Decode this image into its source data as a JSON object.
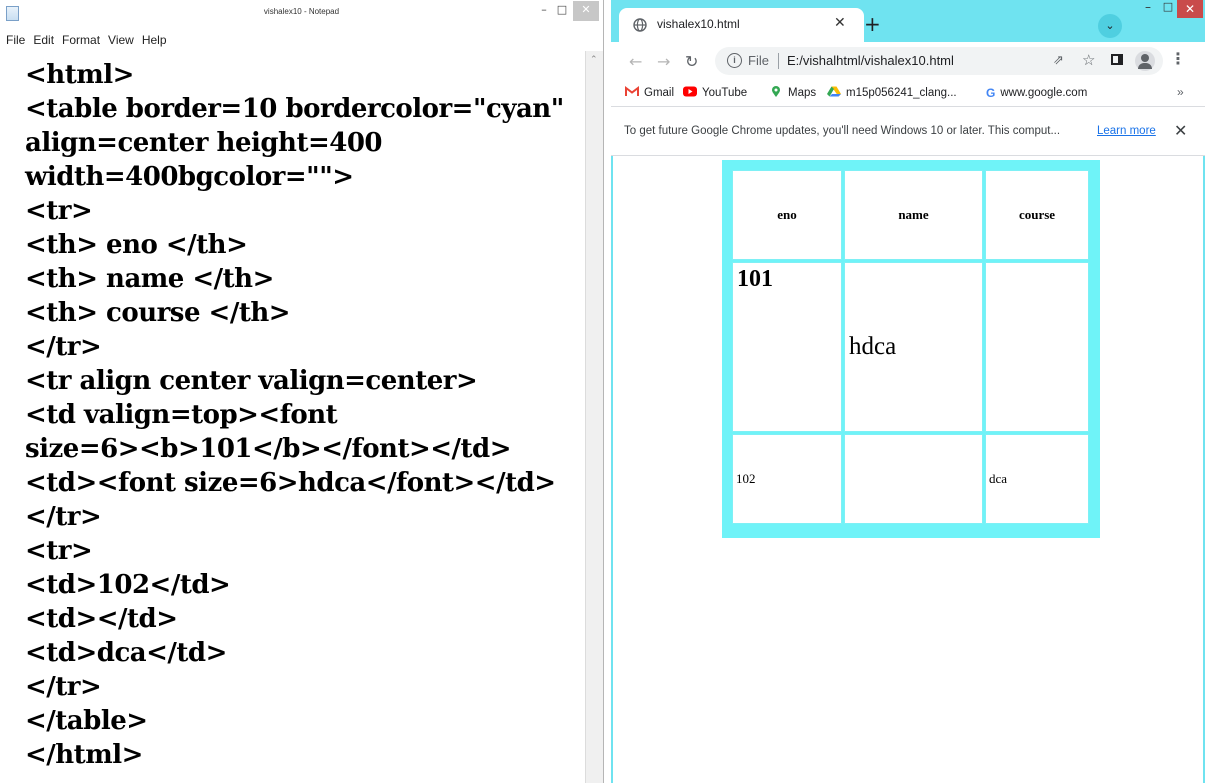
{
  "notepad": {
    "title": "vishalex10 - Notepad",
    "menu": [
      "File",
      "Edit",
      "Format",
      "View",
      "Help"
    ],
    "lines": [
      "<html>",
      "<table border=10 bordercolor=\"cyan\"",
      "align=center height=400",
      "width=400bgcolor=\"\">",
      "<tr>",
      "<th> eno </th>",
      "<th> name </th>",
      "<th> course </th>",
      "</tr>",
      "<tr align center valign=center>",
      "<td valign=top><font",
      "size=6><b>101</b></font></td>",
      "<td><font size=6>hdca</font></td>",
      "</tr>",
      "<tr>",
      "<td>102</td>",
      "<td></td>",
      "<td>dca</td>",
      "</tr>",
      "</table>",
      "</html>"
    ]
  },
  "chrome": {
    "tab_title": "vishalex10.html",
    "url_scheme": "File",
    "url": "E:/vishalhtml/vishalex10.html",
    "bookmarks": [
      {
        "label": "Gmail",
        "icon": "gmail-icon",
        "color": "#ea4335"
      },
      {
        "label": "YouTube",
        "icon": "youtube-icon",
        "color": "#ff0000"
      },
      {
        "label": "Maps",
        "icon": "maps-icon",
        "color": "#34a853"
      },
      {
        "label": "m15p056241_clang...",
        "icon": "drive-icon",
        "color": "#fbbc04"
      },
      {
        "label": "www.google.com",
        "icon": "google-icon",
        "color": "#4285f4"
      }
    ],
    "info_bar": {
      "text": "To get future Google Chrome updates, you'll need Windows 10 or later. This comput...",
      "link": "Learn more"
    },
    "page_table": {
      "headers": [
        "eno",
        "name",
        "course"
      ],
      "row1": {
        "eno": "101",
        "name": "hdca",
        "course": ""
      },
      "row2": {
        "eno": "102",
        "name": "",
        "course": "dca"
      },
      "border_color": "#6ff3f8"
    }
  }
}
